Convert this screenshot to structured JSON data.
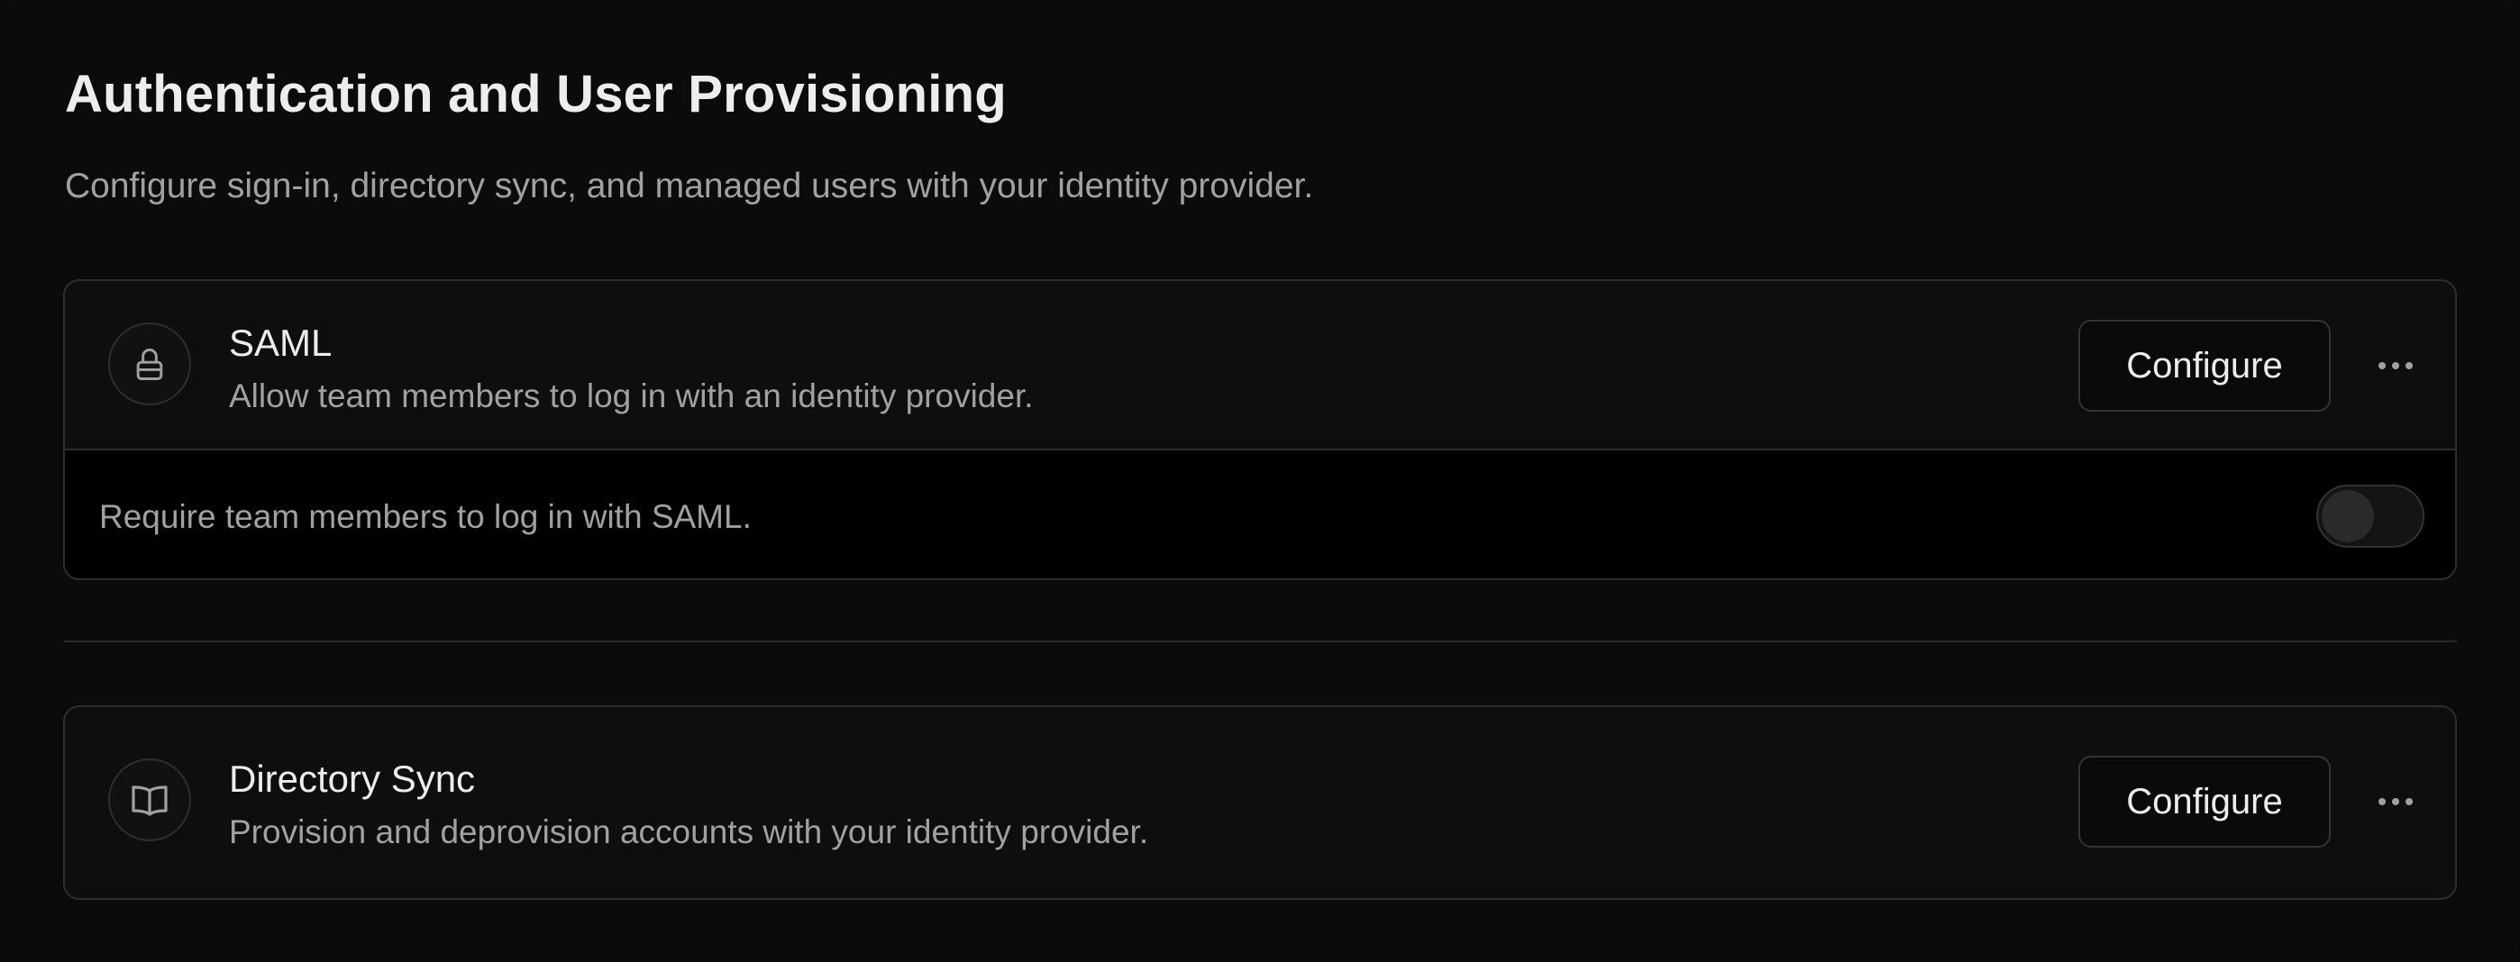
{
  "header": {
    "title": "Authentication and User Provisioning",
    "subtitle": "Configure sign-in, directory sync, and managed users with your identity provider."
  },
  "saml": {
    "icon": "lock-icon",
    "title": "SAML",
    "description": "Allow team members to log in with an identity provider.",
    "configure_label": "Configure",
    "require_label": "Require team members to log in with SAML.",
    "require_enabled": false
  },
  "directory_sync": {
    "icon": "book-icon",
    "title": "Directory Sync",
    "description": "Provision and deprovision accounts with your identity provider.",
    "configure_label": "Configure"
  },
  "colors": {
    "background": "#0a0a0a",
    "card_border": "#2e2e2e",
    "text_primary": "#ededed",
    "text_secondary": "#a1a1a1"
  }
}
